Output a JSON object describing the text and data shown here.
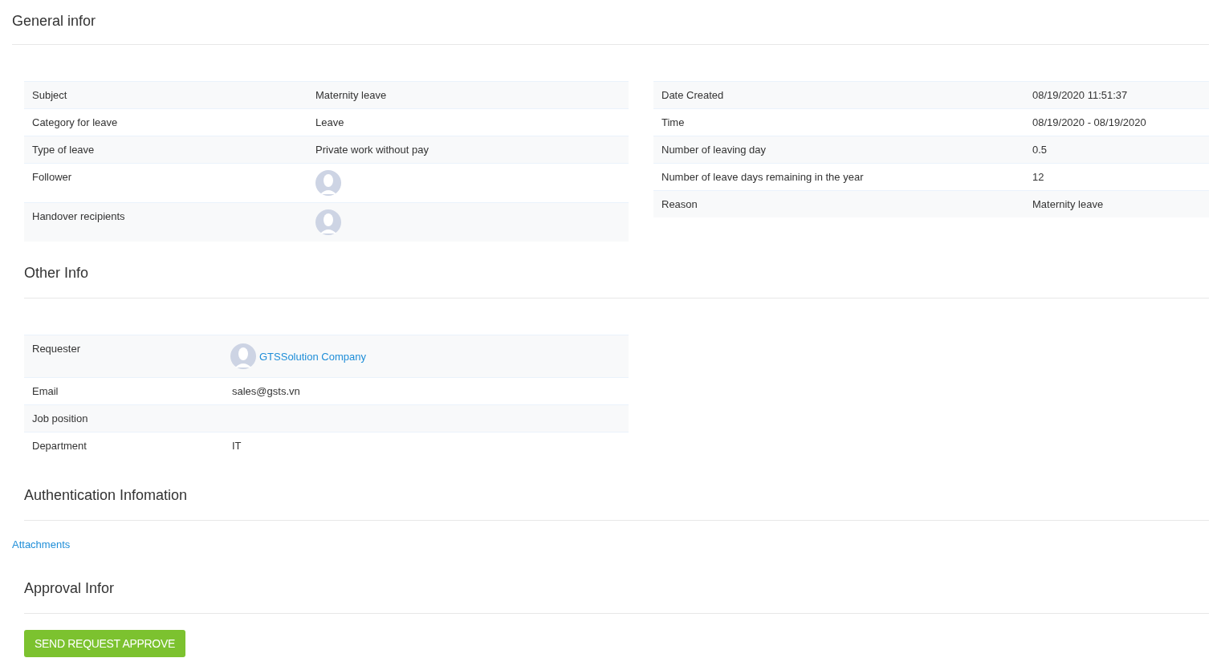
{
  "general": {
    "title": "General infor",
    "left_rows": [
      {
        "label": "Subject",
        "kind": "text",
        "value": "Maternity leave"
      },
      {
        "label": "Category for leave",
        "kind": "text",
        "value": "Leave"
      },
      {
        "label": "Type of leave",
        "kind": "text",
        "value": "Private work without pay"
      },
      {
        "label": "Follower",
        "kind": "avatar"
      },
      {
        "label": "Handover recipients",
        "kind": "avatar"
      }
    ],
    "right_rows": [
      {
        "label": "Date Created",
        "kind": "text",
        "value": "08/19/2020 11:51:37"
      },
      {
        "label": "Time",
        "kind": "text",
        "value": "08/19/2020 - 08/19/2020"
      },
      {
        "label": "Number of leaving day",
        "kind": "text",
        "value": "0.5"
      },
      {
        "label": "Number of leave days remaining in the year",
        "kind": "text",
        "value": "12"
      },
      {
        "label": "Reason",
        "kind": "text",
        "value": "Maternity leave"
      }
    ]
  },
  "other": {
    "title": "Other Info",
    "rows": [
      {
        "label": "Requester",
        "kind": "avatar-link",
        "value": "GTSSolution Company"
      },
      {
        "label": "Email",
        "kind": "text",
        "value": "sales@gsts.vn"
      },
      {
        "label": "Job position",
        "kind": "text"
      },
      {
        "label": "Department",
        "kind": "text",
        "value": "IT"
      }
    ]
  },
  "authentication": {
    "title": "Authentication Infomation",
    "attachments_link": "Attachments"
  },
  "approval": {
    "title": "Approval Infor",
    "button": "SEND REQUEST APPROVE"
  }
}
